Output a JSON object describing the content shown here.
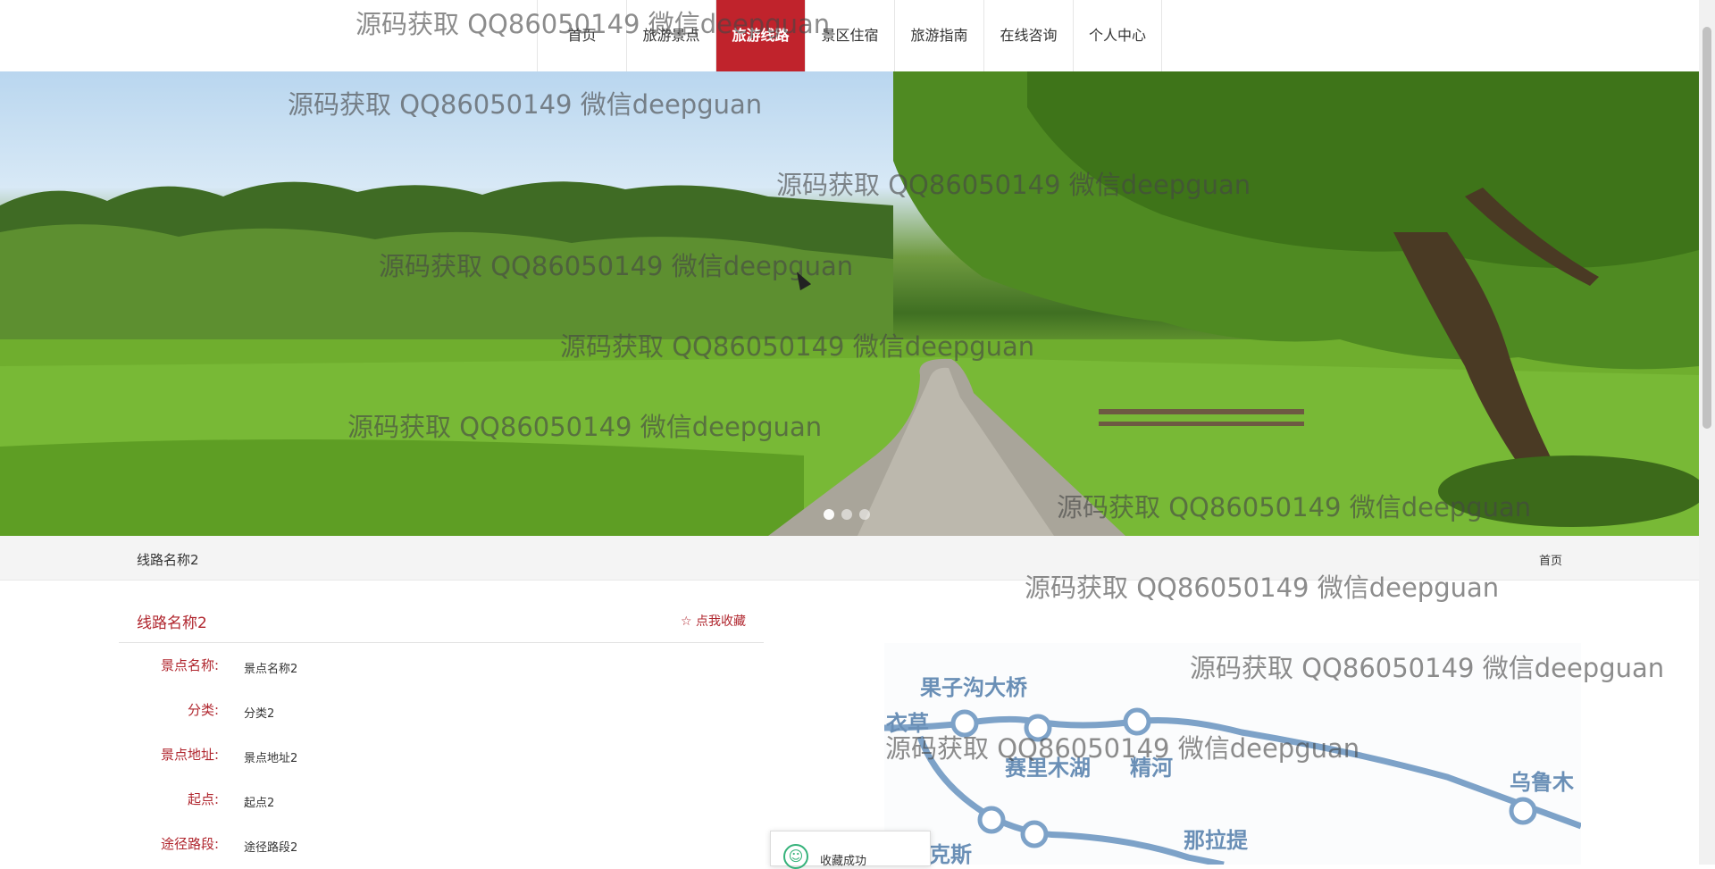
{
  "nav": {
    "items": [
      {
        "label": "首页",
        "active": false
      },
      {
        "label": "旅游景点",
        "active": false
      },
      {
        "label": "旅游线路",
        "active": true
      },
      {
        "label": "景区住宿",
        "active": false
      },
      {
        "label": "旅游指南",
        "active": false
      },
      {
        "label": "在线咨询",
        "active": false
      },
      {
        "label": "个人中心",
        "active": false
      }
    ],
    "active_color": "#c0232c"
  },
  "banner": {
    "slides_total": 3,
    "active_slide": 1
  },
  "breadcrumb": {
    "title": "线路名称2",
    "home": "首页"
  },
  "detail": {
    "title": "线路名称2",
    "favorite_label": "☆ 点我收藏",
    "rows": [
      {
        "label": "景点名称:",
        "value": "景点名称2"
      },
      {
        "label": "分类:",
        "value": "分类2"
      },
      {
        "label": "景点地址:",
        "value": "景点地址2"
      },
      {
        "label": "起点:",
        "value": "起点2"
      },
      {
        "label": "途径路段:",
        "value": "途径路段2"
      }
    ]
  },
  "map": {
    "labels": [
      "果子沟大桥",
      "衣草",
      "赛里木湖",
      "精河",
      "乌鲁木",
      "那拉提",
      "克斯"
    ]
  },
  "toast": {
    "message": "收藏成功"
  },
  "watermark": {
    "text": "源码获取 QQ86050149 微信deepguan"
  },
  "colors": {
    "accent": "#b0262e",
    "toast_icon": "#35b27a"
  }
}
